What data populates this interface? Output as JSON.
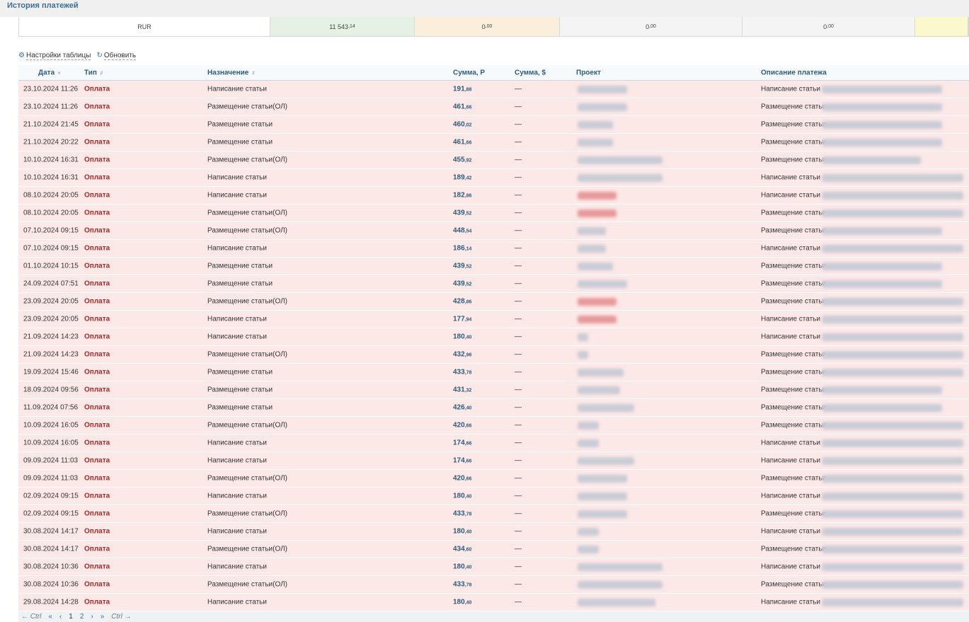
{
  "title": "История платежей",
  "summary": {
    "currency": "RUR",
    "values": [
      {
        "int": "11 543",
        "frac": ",14",
        "color": "#e4f1e4"
      },
      {
        "int": "0",
        "frac": ",00",
        "color": "#fbefdc"
      },
      {
        "int": "0",
        "frac": ",00",
        "color": "#f4f4f4"
      },
      {
        "int": "0",
        "frac": ",00",
        "color": "#f4f4f4"
      }
    ],
    "last_color": "#fbf8cc"
  },
  "toolbar": {
    "settings": "Настройки таблицы",
    "refresh": "Обновить"
  },
  "columns": {
    "date": "Дата",
    "type": "Тип",
    "purpose": "Назначение",
    "sum_rub": "Сумма, Р",
    "sum_usd": "Сумма, $",
    "project": "Проект",
    "description": "Описание платежа"
  },
  "rows": [
    [
      "23.10.2024 11:26",
      "Написание статьи",
      "191",
      ",88",
      0
    ],
    [
      "23.10.2024 11:26",
      "Размещение статьи(ОЛ)",
      "461",
      ",66",
      0
    ],
    [
      "21.10.2024 21:45",
      "Размещение статьи",
      "460",
      ",02",
      0
    ],
    [
      "21.10.2024 20:22",
      "Размещение статьи",
      "461",
      ",66",
      0
    ],
    [
      "10.10.2024 16:31",
      "Размещение статьи(ОЛ)",
      "455",
      ",92",
      0
    ],
    [
      "10.10.2024 16:31",
      "Написание статьи",
      "189",
      ",42",
      0
    ],
    [
      "08.10.2024 20:05",
      "Написание статьи",
      "182",
      ",86",
      1
    ],
    [
      "08.10.2024 20:05",
      "Размещение статьи(ОЛ)",
      "439",
      ",52",
      1
    ],
    [
      "07.10.2024 09:15",
      "Размещение статьи(ОЛ)",
      "448",
      ",54",
      0
    ],
    [
      "07.10.2024 09:15",
      "Написание статьи",
      "186",
      ",14",
      0
    ],
    [
      "01.10.2024 10:15",
      "Размещение статьи",
      "439",
      ",52",
      0
    ],
    [
      "24.09.2024 07:51",
      "Размещение статьи",
      "439",
      ",52",
      0
    ],
    [
      "23.09.2024 20:05",
      "Размещение статьи(ОЛ)",
      "428",
      ",86",
      1
    ],
    [
      "23.09.2024 20:05",
      "Написание статьи",
      "177",
      ",94",
      1
    ],
    [
      "21.09.2024 14:23",
      "Написание статьи",
      "180",
      ",40",
      0
    ],
    [
      "21.09.2024 14:23",
      "Размещение статьи(ОЛ)",
      "432",
      ",96",
      0
    ],
    [
      "19.09.2024 15:46",
      "Размещение статьи",
      "433",
      ",78",
      0
    ],
    [
      "18.09.2024 09:56",
      "Размещение статьи",
      "431",
      ",32",
      0
    ],
    [
      "11.09.2024 07:56",
      "Размещение статьи",
      "426",
      ",40",
      0
    ],
    [
      "10.09.2024 16:05",
      "Размещение статьи(ОЛ)",
      "420",
      ",66",
      0
    ],
    [
      "10.09.2024 16:05",
      "Написание статьи",
      "174",
      ",66",
      0
    ],
    [
      "09.09.2024 11:03",
      "Написание статьи",
      "174",
      ",66",
      0
    ],
    [
      "09.09.2024 11:03",
      "Размещение статьи(ОЛ)",
      "420",
      ",66",
      0
    ],
    [
      "02.09.2024 09:15",
      "Написание статьи",
      "180",
      ",40",
      0
    ],
    [
      "02.09.2024 09:15",
      "Размещение статьи(ОЛ)",
      "433",
      ",78",
      0
    ],
    [
      "30.08.2024 14:17",
      "Написание статьи",
      "180",
      ",40",
      0
    ],
    [
      "30.08.2024 14:17",
      "Размещение статьи(ОЛ)",
      "434",
      ",60",
      0
    ],
    [
      "30.08.2024 10:36",
      "Написание статьи",
      "180",
      ",40",
      0
    ],
    [
      "30.08.2024 10:36",
      "Размещение статьи(ОЛ)",
      "433",
      ",78",
      0
    ],
    [
      "29.08.2024 14:28",
      "Написание статьи",
      "180",
      ",40",
      0
    ]
  ],
  "row_type": "Оплата",
  "usd_placeholder": "—",
  "pager": {
    "prev_ctrl": "← Ctrl",
    "first": "«",
    "prev": "‹",
    "pages": [
      "1",
      "2"
    ],
    "next": "›",
    "last": "»",
    "next_ctrl": "Ctrl →"
  }
}
